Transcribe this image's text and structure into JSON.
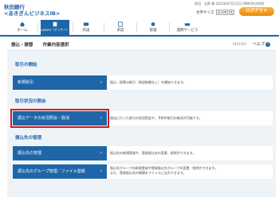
{
  "header": {
    "bank_name": "秋田銀行",
    "service_name": "<あきぎんビジネスIB>",
    "user_line": "秋田　太郎 様  2013年07月13日 09時30分00秒",
    "font_size_label": "文字サイズ",
    "font_size_options": [
      "小",
      "中",
      "大"
    ],
    "logout_label": "ログアウト"
  },
  "nav": {
    "items": [
      {
        "label": "ホーム",
        "icon": "home-icon"
      },
      {
        "label": "ANSER（アンサー）",
        "icon": "anser-icon"
      },
      {
        "label": "伝送",
        "icon": "transfer-icon"
      },
      {
        "label": "承認",
        "icon": "approval-icon"
      },
      {
        "label": "管理",
        "icon": "admin-icon"
      },
      {
        "label": "連携サービス",
        "icon": "link-service-icon"
      }
    ]
  },
  "breadcrumb": {
    "section": "振込・振替",
    "current": "作業内容選択",
    "page_id": "BFKF001",
    "help": "ヘルプ",
    "help_icon": "?"
  },
  "sections": [
    {
      "title": "取引の開始",
      "items": [
        {
          "label": "新規取引",
          "desc": "振込・振替の取引（承認依頼なし）を開始できます。"
        }
      ]
    },
    {
      "title": "取引状況の照会",
      "items": [
        {
          "label": "振込データの状況照会・取消",
          "desc": "過去に行った取引の状況照会や、予約中取引の取消が可能です。"
        }
      ]
    },
    {
      "title": "振込先の管理",
      "items": [
        {
          "label": "振込先の管理",
          "desc": "振込先の新規登録や、登録振込先の変更、削除ができます。"
        },
        {
          "label": "振込先のグループ管理／ファイル登録",
          "desc": "振込先グループの新規登録や登録振込先グループの変更、削除ができます。",
          "desc2": "また、登録振込先の情報をファイルに出力できます。"
        }
      ]
    }
  ],
  "chevron": "›",
  "colors": {
    "brand": "#1f66a8",
    "logout": "#f39c1c",
    "highlight": "#d3191f"
  }
}
